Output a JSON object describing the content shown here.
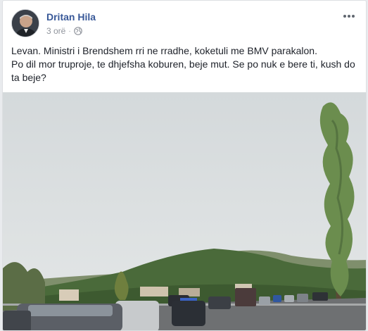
{
  "post": {
    "author": "Dritan Hila",
    "time": "3 orë",
    "separator": "·",
    "privacy_icon": "globe-icon",
    "more_icon": "more-options-icon",
    "text_lines": [
      "Levan. Ministri i Brendshem rri ne rradhe, koketuli me BMV parakalon.",
      "Po dil mor truproje, te dhjefsha koburen, beje mut. Se po nuk e bere ti, kush do ta beje?"
    ],
    "photo": {
      "subject": "road-traffic-photo"
    }
  },
  "colors": {
    "author_link": "#385898",
    "meta_text": "#90949c",
    "body_text": "#1d2129",
    "sky": "#dfe3e4",
    "hill": "#4a6a3a"
  }
}
